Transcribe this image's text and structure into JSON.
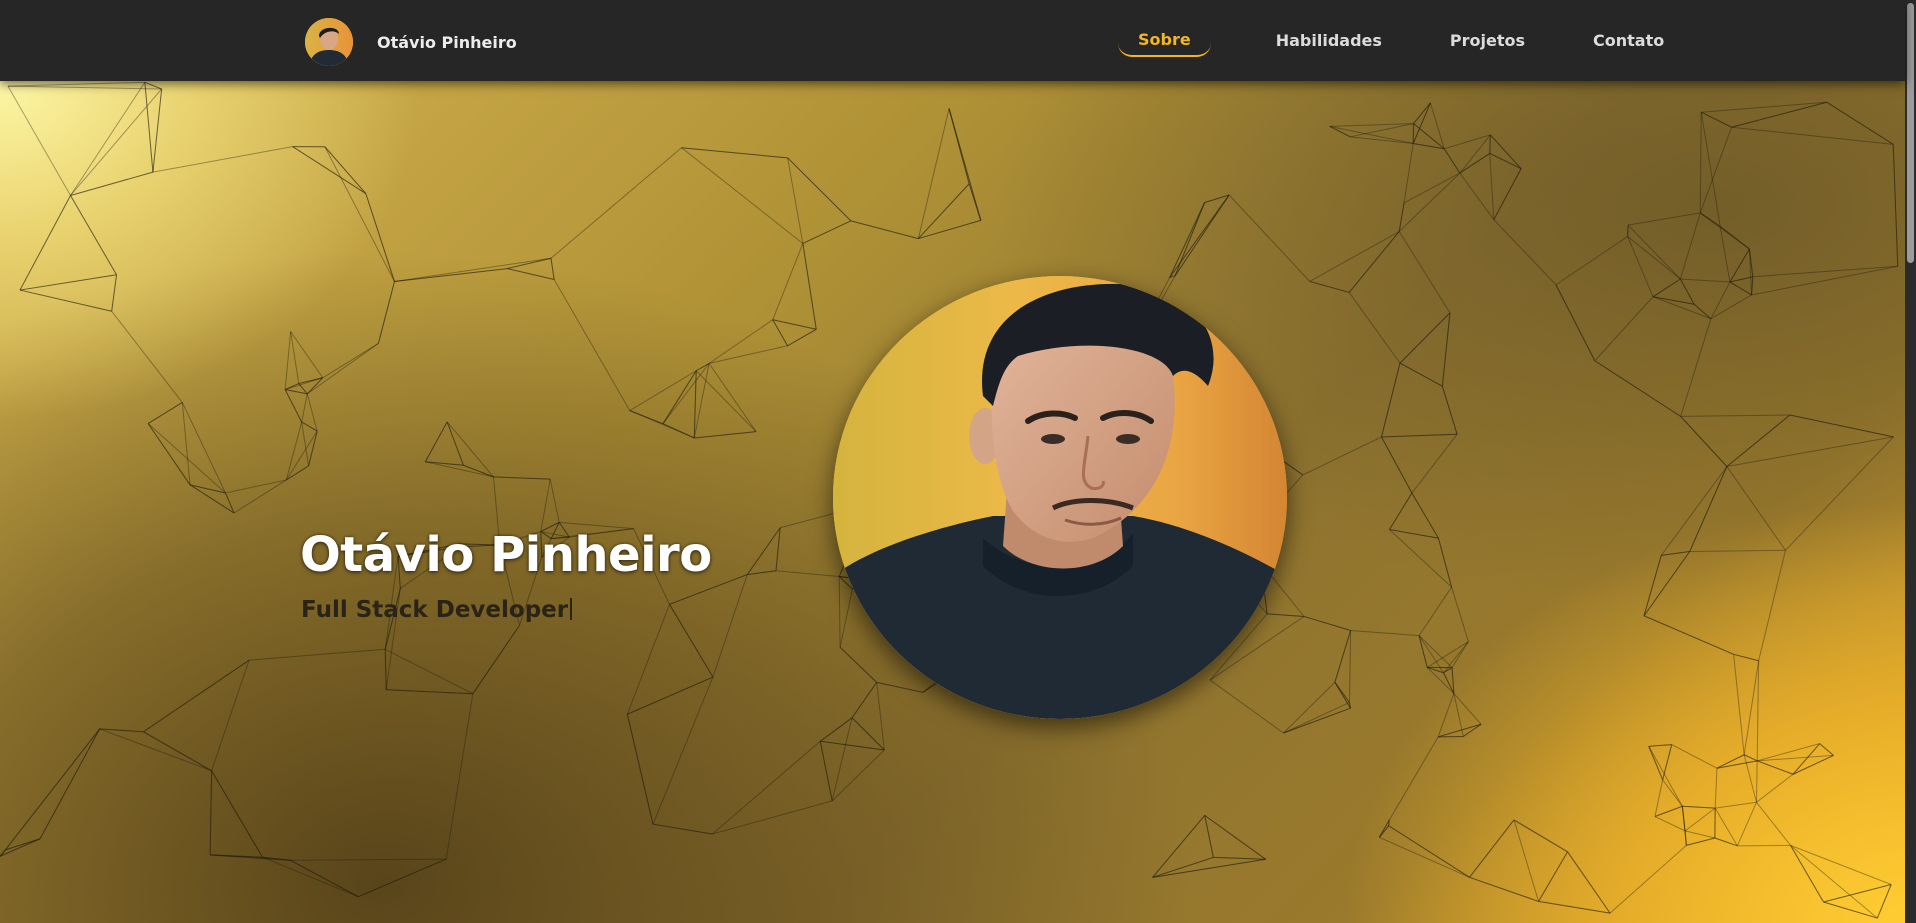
{
  "header": {
    "brand_name": "Otávio Pinheiro",
    "nav": [
      {
        "label": "Sobre",
        "active": true
      },
      {
        "label": "Habilidades",
        "active": false
      },
      {
        "label": "Projetos",
        "active": false
      },
      {
        "label": "Contato",
        "active": false
      }
    ]
  },
  "hero": {
    "name": "Otávio Pinheiro",
    "role": "Full Stack Developer"
  },
  "colors": {
    "accent": "#f5b521",
    "navbar_bg": "#262626",
    "hero_gold": "#b09236"
  }
}
